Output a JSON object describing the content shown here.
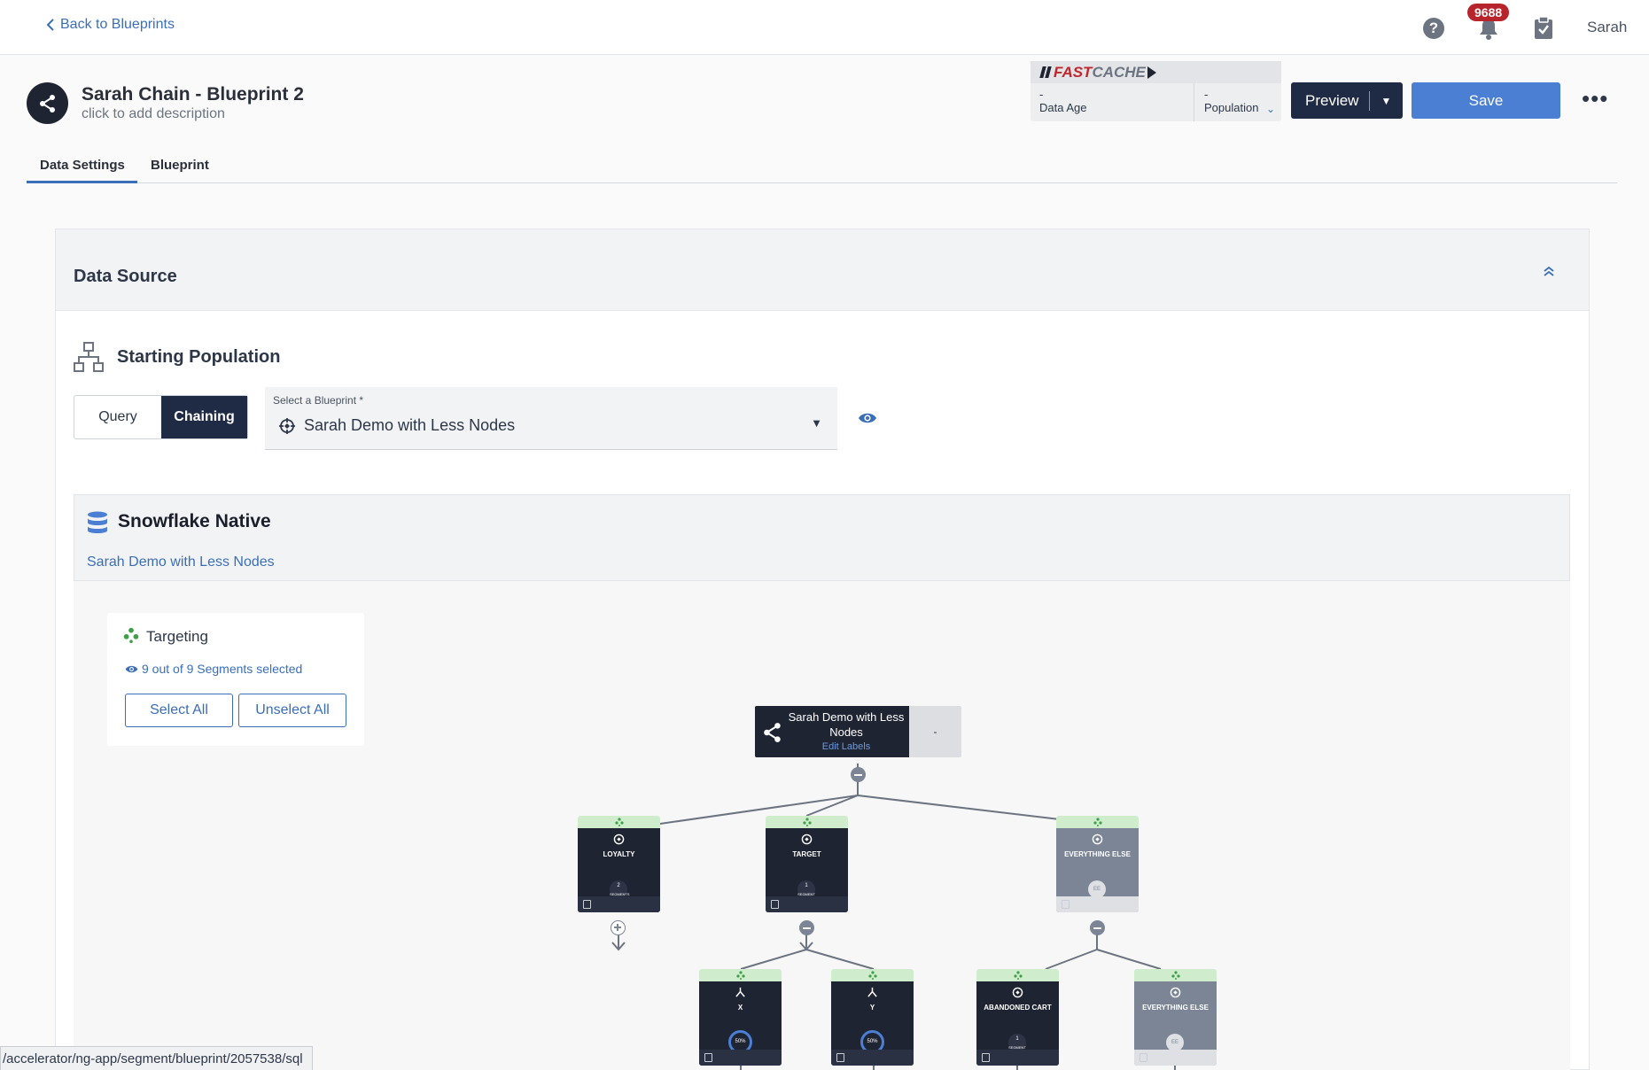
{
  "nav": {
    "back_label": "Back to Blueprints",
    "notification_count": "9688",
    "user_name": "Sarah",
    "help_glyph": "?"
  },
  "blueprint": {
    "title": "Sarah Chain - Blueprint 2",
    "description": "click to add description"
  },
  "fastcache": {
    "brand_fast": "FAST",
    "brand_cache": "CACHE",
    "data_age_value": "-",
    "data_age_label": "Data Age",
    "population_value": "-",
    "population_label": "Population"
  },
  "actions": {
    "preview_label": "Preview",
    "save_label": "Save",
    "more_label": "•••"
  },
  "tabs": [
    {
      "label": "Data Settings",
      "active": true
    },
    {
      "label": "Blueprint",
      "active": false
    }
  ],
  "data_source": {
    "title": "Data Source",
    "starting_population_title": "Starting Population",
    "toggle": {
      "query_label": "Query",
      "chaining_label": "Chaining",
      "selected": "Chaining"
    },
    "select": {
      "label": "Select a Blueprint *",
      "value": "Sarah Demo with Less Nodes"
    },
    "source": {
      "title": "Snowflake Native",
      "link": "Sarah Demo with Less Nodes"
    }
  },
  "targeting": {
    "title": "Targeting",
    "selection_text": "9 out of 9 Segments selected",
    "select_all_label": "Select All",
    "unselect_all_label": "Unselect All"
  },
  "tree": {
    "root": {
      "name": "Sarah Demo with Less Nodes",
      "edit_label": "Edit Labels",
      "value": "-"
    },
    "level1": [
      {
        "name": "LOYALTY",
        "count": "2",
        "count_label": "SEGMENTS",
        "style": "dark"
      },
      {
        "name": "TARGET",
        "count": "1",
        "count_label": "SEGMENT",
        "style": "dark"
      },
      {
        "name": "EVERYTHING ELSE",
        "count": "EE",
        "count_label": "",
        "style": "grey"
      }
    ],
    "level2": [
      {
        "name": "X",
        "percent": "50%",
        "style": "dark"
      },
      {
        "name": "Y",
        "percent": "50%",
        "style": "dark"
      },
      {
        "name": "ABANDONED CART",
        "count": "1",
        "count_label": "SEGMENT",
        "style": "dark"
      },
      {
        "name": "EVERYTHING ELSE",
        "count": "EE",
        "count_label": "",
        "style": "grey"
      }
    ]
  },
  "status_url": "/accelerator/ng-app/segment/blueprint/2057538/sql",
  "colors": {
    "primary": "#4a7fd4",
    "navy": "#1f2a44",
    "node_dark": "#1f2433",
    "node_grey": "#7c8595",
    "node_top": "#cfeccd",
    "badge_red": "#b8242c",
    "link": "#3a6fb8"
  },
  "icons": [
    "chevron-left-icon",
    "help-icon",
    "bell-icon",
    "clipboard-check-icon",
    "share-nodes-icon",
    "chevron-down-icon",
    "chevrons-up-icon",
    "hierarchy-icon",
    "segment-target-icon",
    "eye-icon",
    "database-icon",
    "targeting-icon",
    "split-icon",
    "document-icon",
    "plus-circle-icon",
    "minus-circle-icon"
  ]
}
